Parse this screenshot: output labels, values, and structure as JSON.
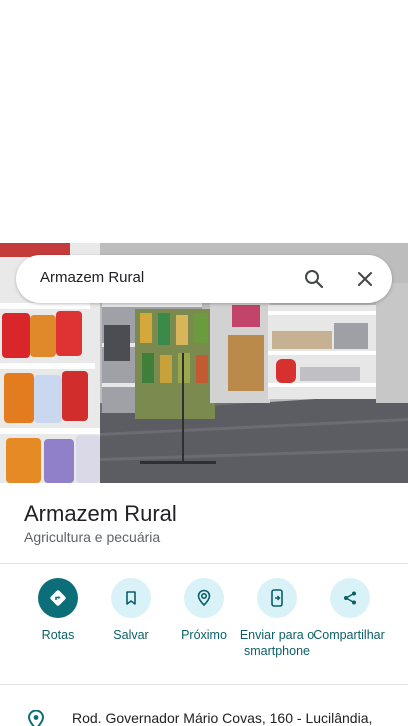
{
  "search": {
    "query": "Armazem Rural"
  },
  "place": {
    "name": "Armazem Rural",
    "category": "Agricultura e pecuária"
  },
  "actions": [
    {
      "label": "Rotas",
      "icon": "directions-icon"
    },
    {
      "label": "Salvar",
      "icon": "bookmark-icon"
    },
    {
      "label": "Próximo",
      "icon": "nearby-icon"
    },
    {
      "label": "Enviar para o smartphone",
      "icon": "send-to-phone-icon"
    },
    {
      "label": "Compartilhar",
      "icon": "share-icon"
    }
  ],
  "address": {
    "text": "Rod. Governador Mário Covas, 160 - Lucilândia,"
  },
  "colors": {
    "accent": "#0b6e78",
    "accent_light": "#d9f2f7",
    "label": "#0b5f68"
  }
}
